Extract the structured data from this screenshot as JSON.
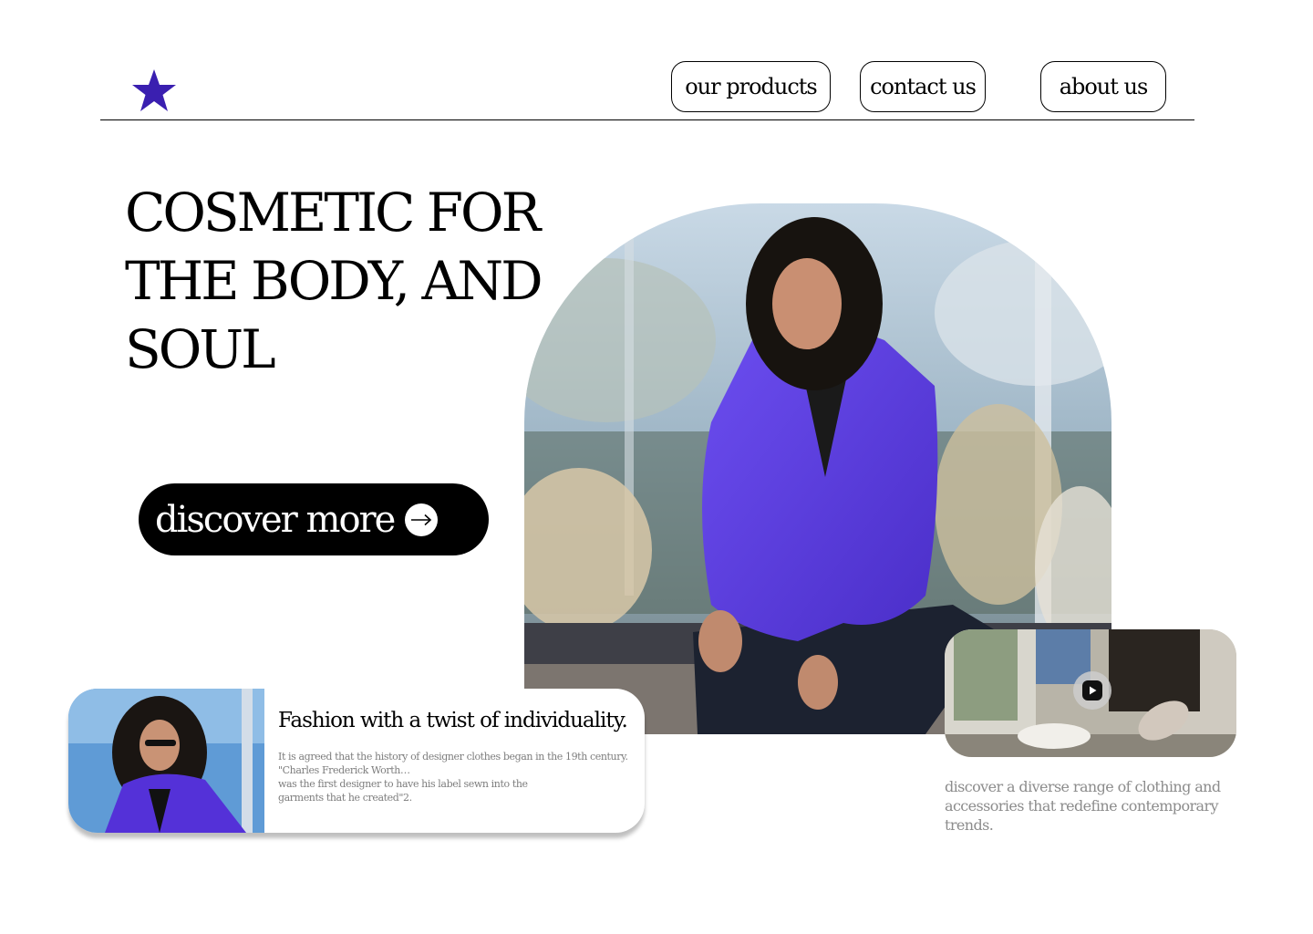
{
  "brand": {
    "logo_icon": "star-icon",
    "accent_color": "#3a1fb0"
  },
  "nav": {
    "items": [
      {
        "label": "our products"
      },
      {
        "label": "contact us"
      },
      {
        "label": "about us"
      }
    ]
  },
  "hero": {
    "title": "COSMETIC FOR THE BODY, AND SOUL",
    "cta_label": "discover more",
    "cta_icon": "arrow-right-icon"
  },
  "info_card": {
    "title": "Fashion with a twist of individuality.",
    "text": "It is agreed that the history of designer clothes began in the 19th century. \"Charles Frederick Worth…\nwas the first designer to have his label sewn into the\ngarments that he created\"2."
  },
  "video_card": {
    "play_icon": "play-icon",
    "caption": "discover a diverse range of clothing and accessories that redefine contemporary trends."
  },
  "colors": {
    "jacket": "#5a3be0",
    "cta_bg": "#000000",
    "caption_gray": "#8c8c8c"
  }
}
